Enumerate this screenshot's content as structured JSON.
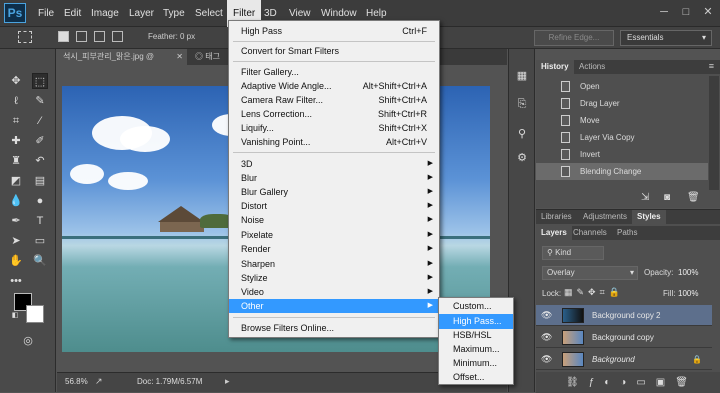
{
  "app": {
    "logo": "Ps"
  },
  "menubar": {
    "items": [
      "File",
      "Edit",
      "Image",
      "Layer",
      "Type",
      "Select",
      "Filter",
      "3D",
      "View",
      "Window",
      "Help"
    ],
    "active": "Filter",
    "window_buttons": [
      "─",
      "□",
      "✕"
    ]
  },
  "options": {
    "feather_label": "Feather:",
    "feather_value": "0 px",
    "refine_edge": "Refine Edge...",
    "workspace": "Essentials"
  },
  "tabs": [
    {
      "label": "석시_피부관리_맑은.jpg @",
      "close": "✕"
    },
    {
      "label": "◎ 태그",
      "close": ""
    },
    {
      "label": "",
      "close": ""
    }
  ],
  "status": {
    "zoom": "56.8%",
    "doc": "Doc: 1.79M/6.57M"
  },
  "filter_menu": {
    "items": [
      {
        "label": "High Pass",
        "shortcut": "Ctrl+F",
        "sub": false
      },
      {
        "sep": true
      },
      {
        "label": "Convert for Smart Filters",
        "shortcut": "",
        "sub": false
      },
      {
        "sep": true
      },
      {
        "label": "Filter Gallery...",
        "shortcut": "",
        "sub": false
      },
      {
        "label": "Adaptive Wide Angle...",
        "shortcut": "Alt+Shift+Ctrl+A",
        "sub": false
      },
      {
        "label": "Camera Raw Filter...",
        "shortcut": "Shift+Ctrl+A",
        "sub": false
      },
      {
        "label": "Lens Correction...",
        "shortcut": "Shift+Ctrl+R",
        "sub": false
      },
      {
        "label": "Liquify...",
        "shortcut": "Shift+Ctrl+X",
        "sub": false
      },
      {
        "label": "Vanishing Point...",
        "shortcut": "Alt+Ctrl+V",
        "sub": false
      },
      {
        "sep": true
      },
      {
        "label": "3D",
        "shortcut": "",
        "sub": true
      },
      {
        "label": "Blur",
        "shortcut": "",
        "sub": true
      },
      {
        "label": "Blur Gallery",
        "shortcut": "",
        "sub": true
      },
      {
        "label": "Distort",
        "shortcut": "",
        "sub": true
      },
      {
        "label": "Noise",
        "shortcut": "",
        "sub": true
      },
      {
        "label": "Pixelate",
        "shortcut": "",
        "sub": true
      },
      {
        "label": "Render",
        "shortcut": "",
        "sub": true
      },
      {
        "label": "Sharpen",
        "shortcut": "",
        "sub": true
      },
      {
        "label": "Stylize",
        "shortcut": "",
        "sub": true
      },
      {
        "label": "Video",
        "shortcut": "",
        "sub": true
      },
      {
        "label": "Other",
        "shortcut": "",
        "sub": true,
        "highlight": true
      },
      {
        "sep": true
      },
      {
        "label": "Browse Filters Online...",
        "shortcut": "",
        "sub": false
      }
    ]
  },
  "other_submenu": {
    "items": [
      "Custom...",
      "High Pass...",
      "HSB/HSL",
      "Maximum...",
      "Minimum...",
      "Offset..."
    ],
    "highlight": "High Pass..."
  },
  "history": {
    "tabs": [
      "History",
      "Actions"
    ],
    "rows": [
      "Open",
      "Drag Layer",
      "Move",
      "Layer Via Copy",
      "Invert",
      "Blending Change"
    ],
    "active": "Blending Change"
  },
  "layers": {
    "top_tabs": [
      "Libraries",
      "Adjustments",
      "Styles"
    ],
    "tabs": [
      "Layers",
      "Channels",
      "Paths"
    ],
    "kind": "Kind",
    "blend_mode": "Overlay",
    "opacity_label": "Opacity:",
    "opacity": "100%",
    "lock_label": "Lock:",
    "fill_label": "Fill:",
    "fill": "100%",
    "rows": [
      {
        "name": "Background copy 2",
        "active": true,
        "locked": false
      },
      {
        "name": "Background copy",
        "active": false,
        "locked": false
      },
      {
        "name": "Background",
        "active": false,
        "locked": true
      }
    ]
  },
  "colors": {
    "menu_highlight": "#3399ff",
    "bg": "#535353"
  }
}
